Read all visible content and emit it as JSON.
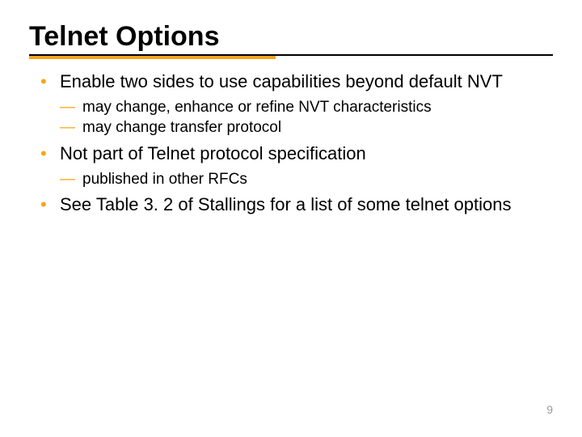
{
  "title": "Telnet Options",
  "bullets": [
    {
      "text": "Enable two sides to use capabilities beyond default NVT",
      "sub": [
        "may change, enhance or refine NVT characteristics",
        "may change transfer protocol"
      ]
    },
    {
      "text": "Not part of Telnet protocol specification",
      "sub": [
        "published in other RFCs"
      ]
    },
    {
      "text": "See Table 3. 2 of Stallings for a list of some telnet options",
      "sub": []
    }
  ],
  "page_number": "9"
}
